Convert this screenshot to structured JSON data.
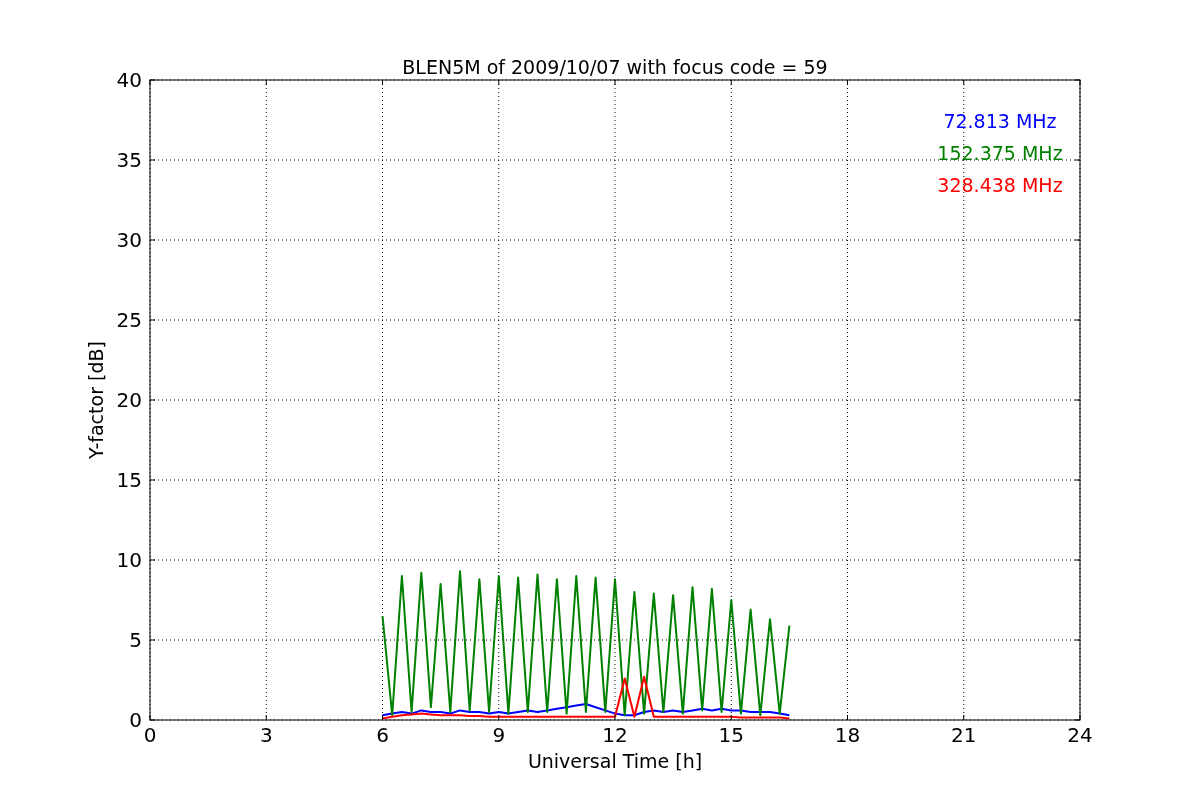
{
  "chart_data": {
    "type": "line",
    "title": "BLEN5M of 2009/10/07 with focus code = 59",
    "xlabel": "Universal Time [h]",
    "ylabel": "Y-factor [dB]",
    "x": [
      6,
      6.25,
      6.5,
      6.75,
      7,
      7.25,
      7.5,
      7.75,
      8,
      8.25,
      8.5,
      8.75,
      9,
      9.25,
      9.5,
      9.75,
      10,
      10.25,
      10.5,
      10.75,
      11,
      11.25,
      11.5,
      11.75,
      12,
      12.25,
      12.5,
      12.75,
      13,
      13.25,
      13.5,
      13.75,
      14,
      14.25,
      14.5,
      14.75,
      15,
      15.25,
      15.5,
      15.75,
      16,
      16.25,
      16.5
    ],
    "series": [
      {
        "name": "72.813 MHz",
        "color": "#0000ff",
        "values": [
          0.3,
          0.4,
          0.5,
          0.4,
          0.6,
          0.5,
          0.5,
          0.4,
          0.6,
          0.5,
          0.5,
          0.4,
          0.5,
          0.4,
          0.5,
          0.6,
          0.5,
          0.6,
          0.7,
          0.8,
          0.9,
          1.0,
          0.8,
          0.6,
          0.4,
          0.3,
          0.3,
          0.5,
          0.6,
          0.5,
          0.6,
          0.5,
          0.6,
          0.7,
          0.6,
          0.7,
          0.6,
          0.6,
          0.5,
          0.5,
          0.5,
          0.4,
          0.3
        ]
      },
      {
        "name": "152.375 MHz",
        "color": "#008000",
        "values": [
          6.5,
          0.3,
          9.0,
          0.5,
          9.2,
          0.8,
          8.5,
          0.5,
          9.3,
          0.6,
          8.8,
          0.5,
          9.0,
          0.4,
          8.9,
          0.5,
          9.1,
          0.5,
          8.8,
          0.4,
          9.0,
          0.5,
          8.9,
          0.5,
          8.8,
          0.3,
          8.0,
          0.4,
          7.9,
          0.5,
          7.8,
          0.4,
          8.3,
          0.6,
          8.2,
          0.5,
          7.5,
          0.4,
          6.9,
          0.3,
          6.3,
          0.4,
          5.9
        ]
      },
      {
        "name": "328.438 MHz",
        "color": "#ff0000",
        "values": [
          0.1,
          0.2,
          0.3,
          0.35,
          0.4,
          0.35,
          0.3,
          0.3,
          0.3,
          0.25,
          0.25,
          0.2,
          0.2,
          0.2,
          0.2,
          0.2,
          0.2,
          0.2,
          0.2,
          0.2,
          0.2,
          0.2,
          0.2,
          0.2,
          0.2,
          2.6,
          0.2,
          2.7,
          0.2,
          0.2,
          0.2,
          0.2,
          0.2,
          0.2,
          0.2,
          0.2,
          0.2,
          0.15,
          0.15,
          0.15,
          0.15,
          0.15,
          0.1
        ]
      }
    ],
    "xlim": [
      0,
      24
    ],
    "ylim": [
      0,
      40
    ],
    "xticks": [
      0,
      3,
      6,
      9,
      12,
      15,
      18,
      21,
      24
    ],
    "yticks": [
      0,
      5,
      10,
      15,
      20,
      25,
      30,
      35,
      40
    ],
    "grid": true
  }
}
